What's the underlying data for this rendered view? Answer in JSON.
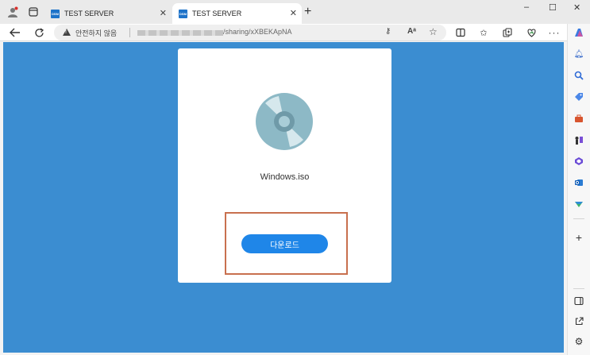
{
  "browser": {
    "tabs": [
      {
        "label": "TEST SERVER",
        "favicon": "DSM",
        "active": false
      },
      {
        "label": "TEST SERVER",
        "favicon": "DSM",
        "active": true
      }
    ],
    "new_tab_icon": "+",
    "window_controls": {
      "minimize": "–",
      "maximize": "☐",
      "close": "✕"
    },
    "address": {
      "security_label": "안전하지 않음",
      "url_path": "/sharing/xXBEKApNA"
    }
  },
  "page": {
    "file_name": "Windows.iso",
    "download_label": "다운로드",
    "background_color": "#3b8dd1",
    "button_color": "#1f86e8",
    "highlight_color": "#c8704e",
    "file_icon": "disc-icon"
  }
}
